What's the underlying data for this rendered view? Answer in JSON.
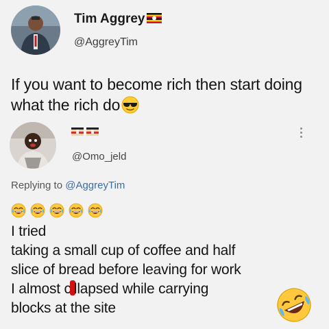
{
  "original_tweet": {
    "display_name": "Tim Aggrey",
    "handle": "@AggreyTim",
    "text": "If you want to become rich then start doing what the rich do",
    "flag_icon": "uganda-flag-icon",
    "emoji_icon": "sunglasses-emoji-icon"
  },
  "reply": {
    "handle": "@Omo_jeld",
    "flags_icon": "flag-emoji-icons",
    "replying_prefix": "Replying to",
    "replying_to": "@AggreyTim",
    "laugh_emoji_icon": "tears-of-joy-emoji-icon",
    "laugh_emoji_count": 5,
    "lines": [
      "I tried",
      "taking a small cup of coffee and half",
      "slice of bread before leaving for work",
      "I almost c",
      "llapsed while carrying",
      "blocks at the site"
    ],
    "rofl_emoji_icon": "rolling-on-floor-laughing-emoji-icon",
    "more_icon": "more-vertical-icon"
  },
  "colors": {
    "background": "#f2f2f2",
    "text": "#141414",
    "mention": "#3a6ea5",
    "red_mark": "#d11010"
  }
}
